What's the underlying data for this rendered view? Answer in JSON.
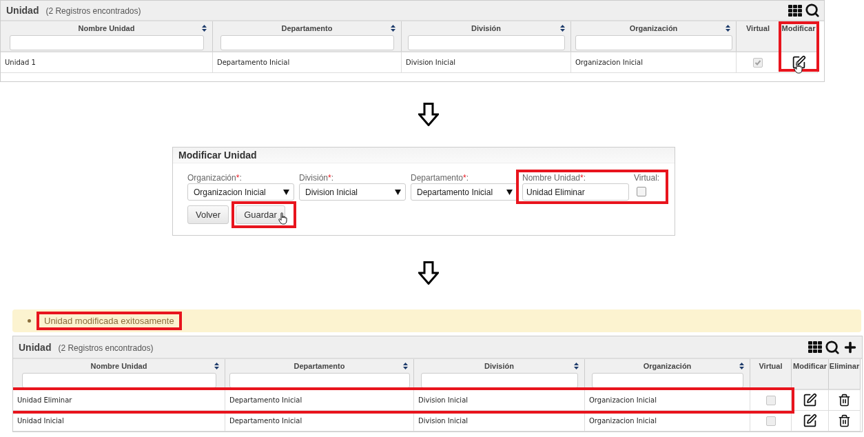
{
  "list_before": {
    "title": "Unidad",
    "count": "(2 Registros encontrados)",
    "toolbar": [
      {
        "kind": "grid"
      },
      {
        "kind": "search"
      }
    ],
    "columns": [
      {
        "label": "Nombre Unidad",
        "kind": "text",
        "sortable": true,
        "filter": true,
        "highlighted": false
      },
      {
        "label": "Departamento",
        "kind": "text",
        "sortable": true,
        "filter": true,
        "highlighted": false
      },
      {
        "label": "División",
        "kind": "text",
        "sortable": true,
        "filter": true,
        "highlighted": false
      },
      {
        "label": "Organización",
        "kind": "text",
        "sortable": true,
        "filter": true,
        "highlighted": false
      },
      {
        "label": "Virtual",
        "kind": "check",
        "sortable": false,
        "filter": false,
        "highlighted": false
      },
      {
        "label": "Modificar",
        "kind": "edit",
        "sortable": false,
        "filter": false,
        "highlighted": true
      }
    ],
    "rows": [
      {
        "cells": [
          "Unidad 1",
          "Departamento Inicial",
          "Division Inicial",
          "Organizacion Inicial"
        ],
        "virtual": true,
        "highlighted": false,
        "pointer": true
      }
    ]
  },
  "form": {
    "title": "Modificar Unidad",
    "fields": [
      {
        "kind": "select",
        "label": "Organización",
        "required_mark": "*",
        "suffix": ":",
        "value": "Organizacion Inicial",
        "highlighted": false
      },
      {
        "kind": "select",
        "label": "División",
        "required_mark": "*",
        "suffix": ":",
        "value": "Division Inicial",
        "highlighted": false
      },
      {
        "kind": "select",
        "label": "Departamento",
        "required_mark": "*",
        "suffix": ":",
        "value": "Departamento Inicial",
        "highlighted": false
      },
      {
        "kind": "text",
        "label": "Nombre Unidad",
        "required_mark": "*",
        "suffix": ":",
        "value": "Unidad Eliminar",
        "highlighted": true
      },
      {
        "kind": "checkbox",
        "label": "Virtual",
        "suffix": ":",
        "checked": false,
        "highlighted": true
      }
    ],
    "buttons": [
      {
        "label": "Volver",
        "highlighted": false,
        "pointer": false
      },
      {
        "label": "Guardar",
        "highlighted": true,
        "pointer": true
      }
    ]
  },
  "message": {
    "text": "Unidad modificada exitosamente",
    "highlighted": true
  },
  "list_after": {
    "title": "Unidad",
    "count": "(2 Registros encontrados)",
    "toolbar": [
      {
        "kind": "grid"
      },
      {
        "kind": "search"
      },
      {
        "kind": "add"
      }
    ],
    "columns": [
      {
        "label": "Nombre Unidad",
        "kind": "text",
        "sortable": true,
        "filter": true,
        "highlighted": false
      },
      {
        "label": "Departamento",
        "kind": "text",
        "sortable": true,
        "filter": true,
        "highlighted": false
      },
      {
        "label": "División",
        "kind": "text",
        "sortable": true,
        "filter": true,
        "highlighted": false
      },
      {
        "label": "Organización",
        "kind": "text",
        "sortable": true,
        "filter": true,
        "highlighted": false
      },
      {
        "label": "Virtual",
        "kind": "check",
        "sortable": false,
        "filter": false,
        "highlighted": false
      },
      {
        "label": "Modificar",
        "kind": "edit",
        "sortable": false,
        "filter": false,
        "highlighted": false
      },
      {
        "label": "Eliminar",
        "kind": "delete",
        "sortable": false,
        "filter": false,
        "highlighted": false
      }
    ],
    "rows": [
      {
        "cells": [
          "Unidad Eliminar",
          "Departamento Inicial",
          "Division Inicial",
          "Organizacion Inicial"
        ],
        "virtual": false,
        "highlighted": true
      },
      {
        "cells": [
          "Unidad Inicial",
          "Departamento Inicial",
          "Division Inicial",
          "Organizacion Inicial"
        ],
        "virtual": false,
        "highlighted": false
      }
    ]
  }
}
